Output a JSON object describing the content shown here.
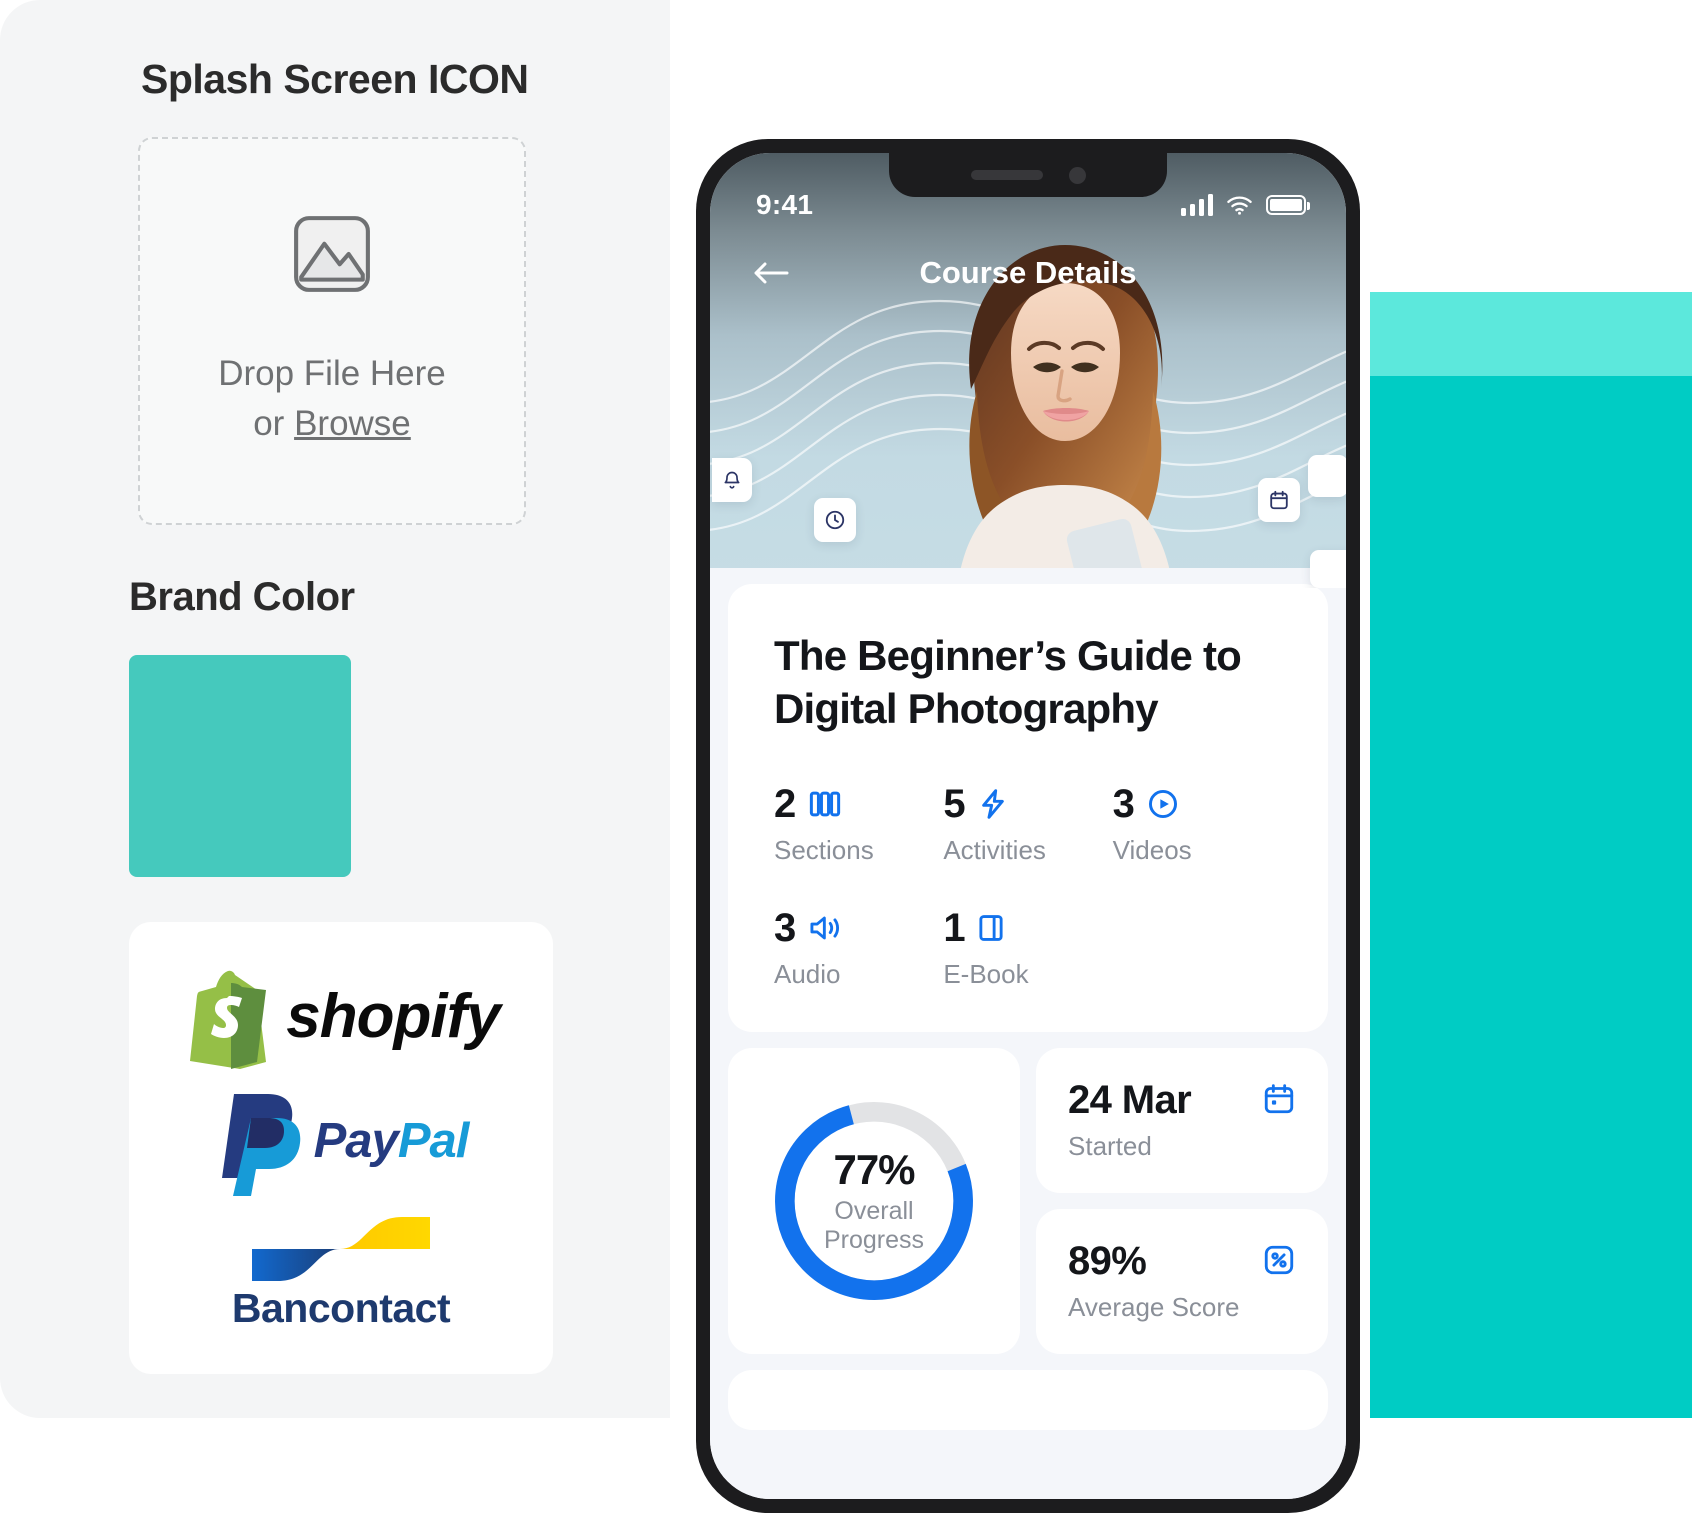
{
  "left": {
    "splash_heading": "Splash Screen ICON",
    "dropzone": {
      "icon": "image-placeholder-icon",
      "line1": "Drop File Here",
      "or_text": "or ",
      "browse_label": "Browse"
    },
    "brand_heading": "Brand Color",
    "brand_color_hex": "#45C9BD",
    "payment_logos": [
      {
        "name": "shopify",
        "wordmark": "shopify",
        "color": "#95BF47"
      },
      {
        "name": "paypal",
        "wordmark_dark": "Pay",
        "wordmark_light": "Pal",
        "color_dark": "#253B80",
        "color_light": "#179BD7"
      },
      {
        "name": "bancontact",
        "wordmark": "Bancontact",
        "color_blue": "#1E5BBF",
        "color_yellow": "#FFD200"
      }
    ]
  },
  "right_panel": {
    "color_top": "#5CE8DC",
    "color_main": "#00CCC4"
  },
  "phone": {
    "frame_color": "#1c1c1e",
    "statusbar": {
      "time": "9:41",
      "icons": [
        "signal-bars-icon",
        "wifi-icon",
        "battery-icon"
      ]
    },
    "navbar": {
      "back_icon": "arrow-left-icon",
      "title": "Course Details"
    },
    "hero": {
      "floating_badges": [
        "bell-icon",
        "clock-icon",
        "calendar-icon",
        "square-icon",
        "half-square-icon"
      ]
    },
    "course": {
      "title": "The Beginner’s Guide to Digital Photography",
      "stats": [
        {
          "value": "2",
          "label": "Sections",
          "icon": "columns-icon"
        },
        {
          "value": "5",
          "label": "Activities",
          "icon": "lightning-icon"
        },
        {
          "value": "3",
          "label": "Videos",
          "icon": "play-circle-icon"
        },
        {
          "value": "3",
          "label": "Audio",
          "icon": "speaker-icon"
        },
        {
          "value": "1",
          "label": "E-Book",
          "icon": "book-icon"
        }
      ]
    },
    "progress": {
      "percent_text": "77%",
      "percent_value": 77,
      "label_line1": "Overall",
      "label_line2": "Progress",
      "arc_color": "#1272ED",
      "track_color": "#E2E3E5"
    },
    "side_cards": [
      {
        "value": "24 Mar",
        "label": "Started",
        "icon": "calendar-icon"
      },
      {
        "value": "89%",
        "label": "Average Score",
        "icon": "percent-badge-icon"
      }
    ],
    "accent_blue": "#1272ED"
  }
}
